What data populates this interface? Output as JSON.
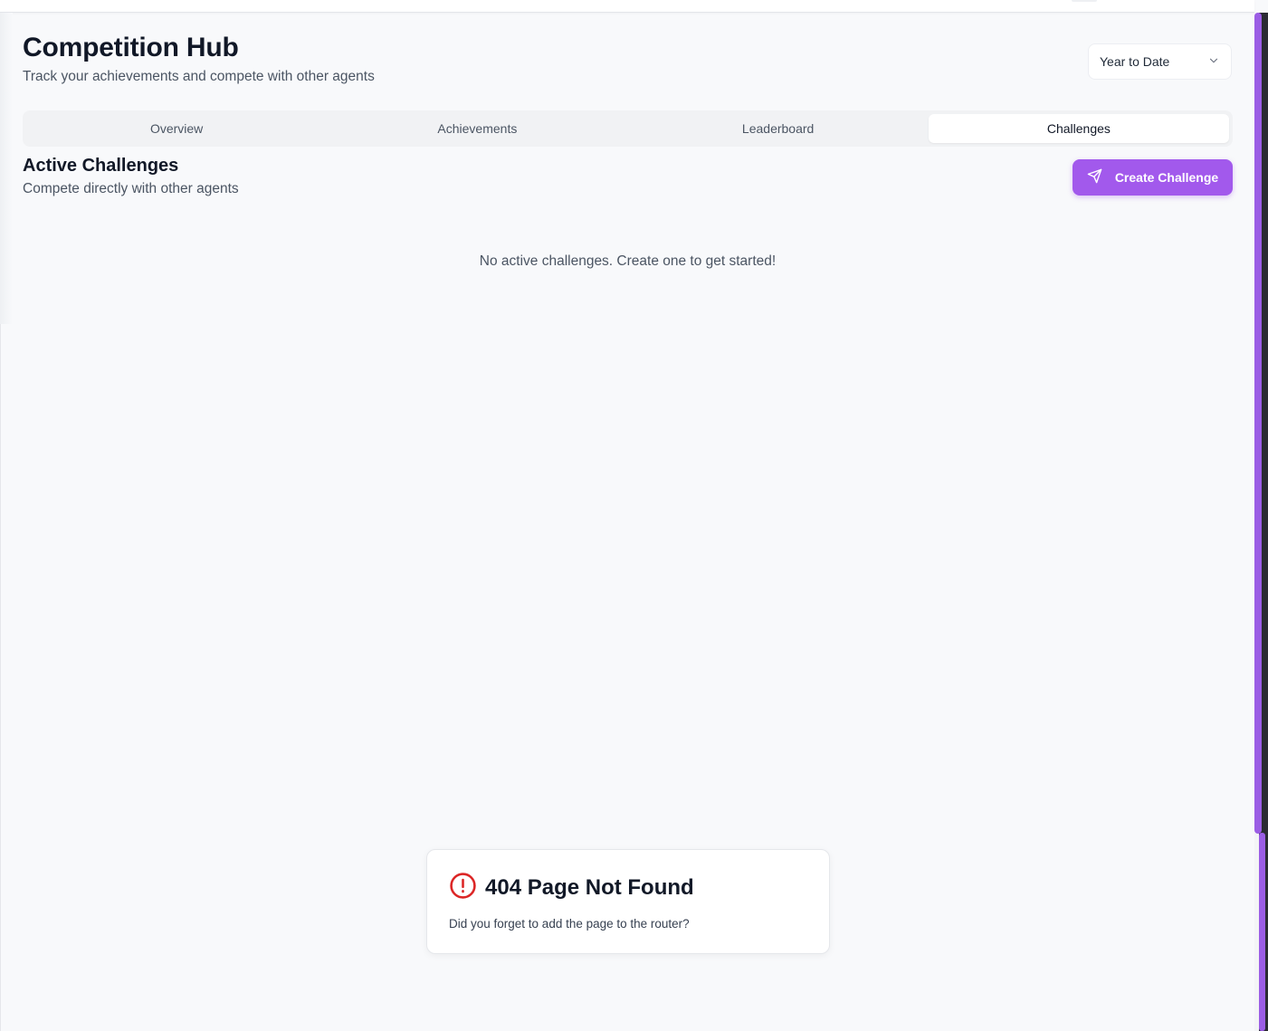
{
  "header": {
    "title": "Competition Hub",
    "subtitle": "Track your achievements and compete with other agents",
    "period_select": {
      "value": "Year to Date",
      "icon": "chevron-down-icon"
    }
  },
  "tabs": [
    {
      "label": "Overview",
      "active": false
    },
    {
      "label": "Achievements",
      "active": false
    },
    {
      "label": "Leaderboard",
      "active": false
    },
    {
      "label": "Challenges",
      "active": true
    }
  ],
  "challenges": {
    "title": "Active Challenges",
    "subtitle": "Compete directly with other agents",
    "create_button": {
      "label": "Create Challenge",
      "icon": "send-icon"
    },
    "empty_message": "No active challenges. Create one to get started!"
  },
  "error_toast": {
    "title": "404 Page Not Found",
    "message": "Did you forget to add the page to the router?",
    "icon": "alert-circle-icon"
  },
  "colors": {
    "accent": "#a259ec",
    "scrollbar": "#9b5de5",
    "error": "#dc2626",
    "background": "#f8f9fb"
  }
}
